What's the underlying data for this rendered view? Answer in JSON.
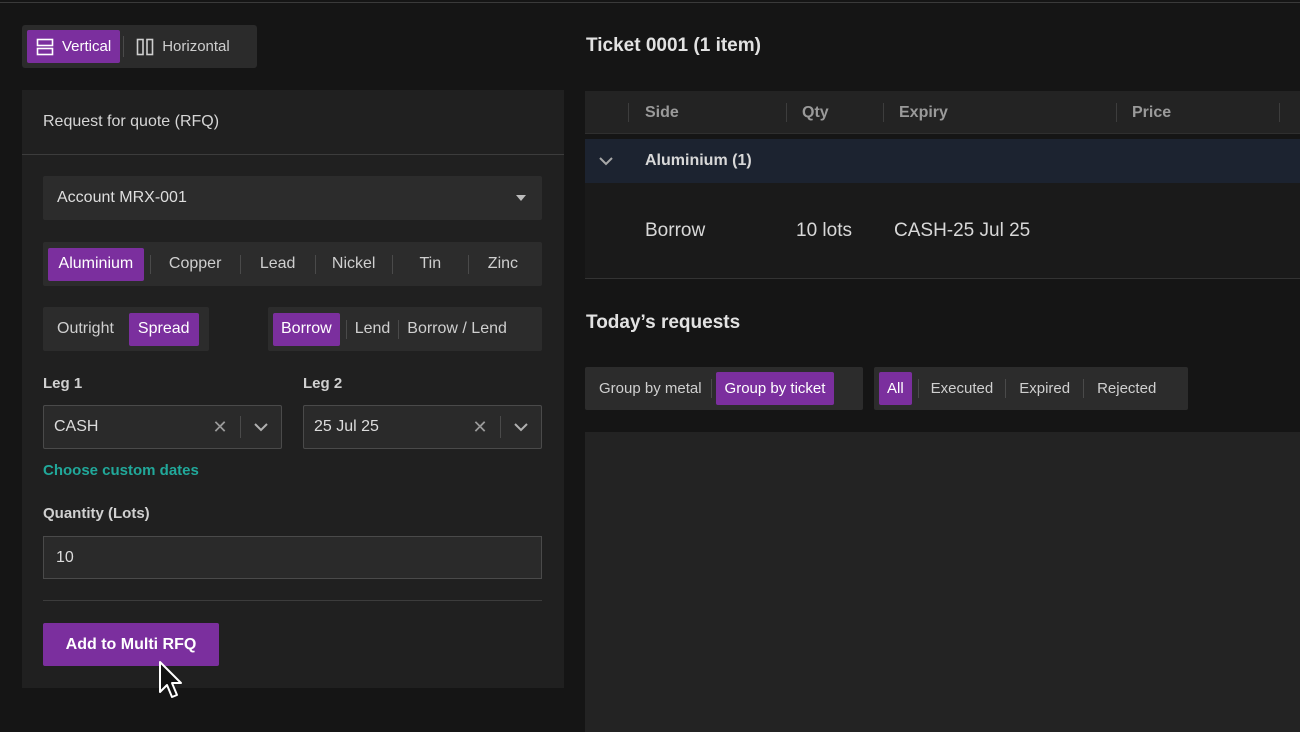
{
  "layout_toggle": {
    "vertical_label": "Vertical",
    "horizontal_label": "Horizontal"
  },
  "rfq": {
    "title": "Request for quote (RFQ)",
    "account": "Account MRX-001",
    "metals": [
      "Aluminium",
      "Copper",
      "Lead",
      "Nickel",
      "Tin",
      "Zinc"
    ],
    "metal_selected": "Aluminium",
    "types": [
      "Outright",
      "Spread"
    ],
    "type_selected": "Spread",
    "directions": [
      "Borrow",
      "Lend",
      "Borrow / Lend"
    ],
    "direction_selected": "Borrow",
    "leg1_label": "Leg 1",
    "leg1_value": "CASH",
    "leg2_label": "Leg 2",
    "leg2_value": "25 Jul 25",
    "custom_dates_link": "Choose custom dates",
    "quantity_label": "Quantity (Lots)",
    "quantity_value": "10",
    "add_button": "Add to Multi RFQ"
  },
  "ticket": {
    "title": "Ticket 0001 (1 item)",
    "columns": [
      "Side",
      "Qty",
      "Expiry",
      "Price"
    ],
    "group_label": "Aluminium (1)",
    "row": {
      "side": "Borrow",
      "qty": "10 lots",
      "expiry": "CASH-25 Jul 25"
    }
  },
  "requests": {
    "title": "Today’s requests",
    "group_options": [
      "Group by metal",
      "Group by ticket"
    ],
    "group_selected": "Group by ticket",
    "filters": [
      "All",
      "Executed",
      "Expired",
      "Rejected"
    ],
    "filter_selected": "All"
  },
  "colors": {
    "accent": "#7b2f9e",
    "link": "#21a89a",
    "group_row": "#1c2330"
  }
}
